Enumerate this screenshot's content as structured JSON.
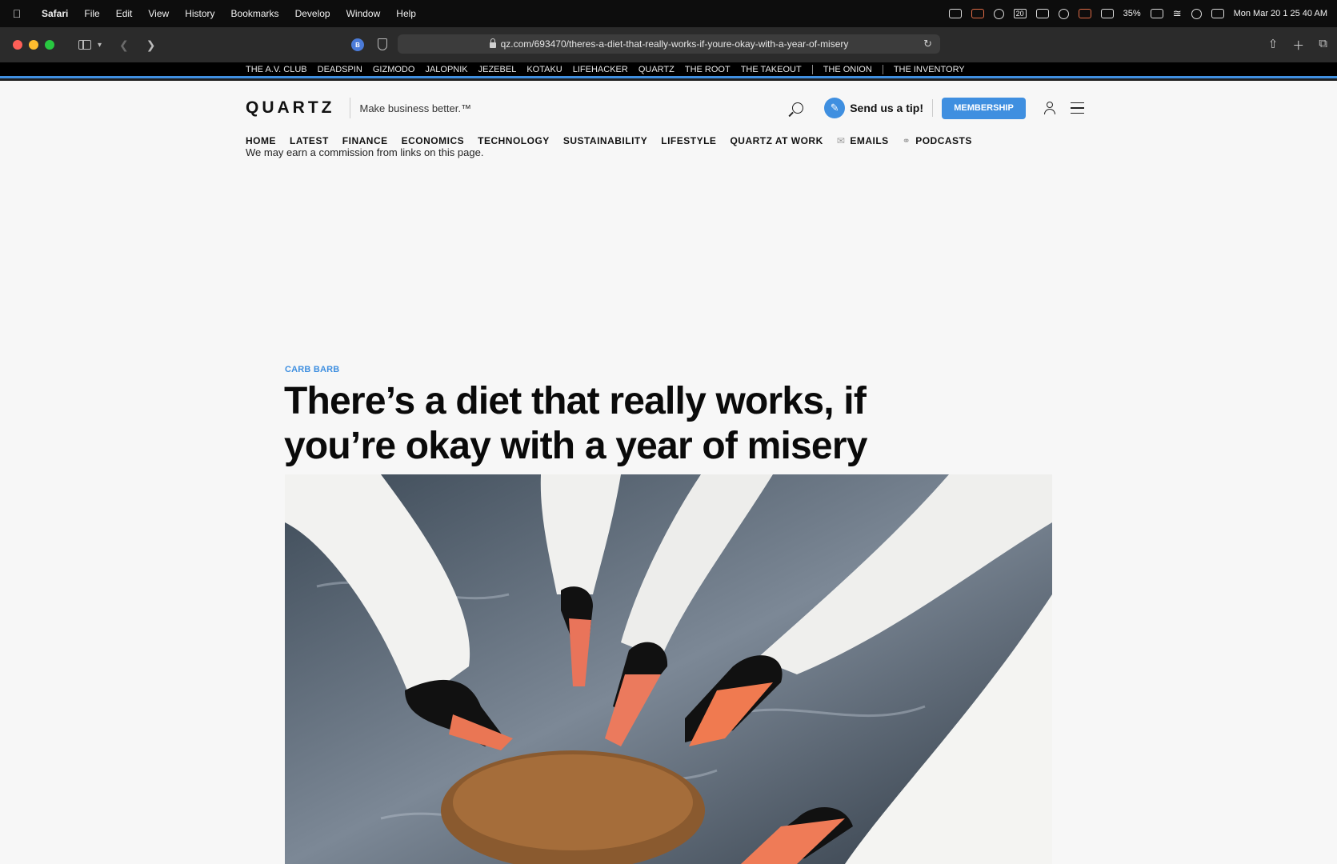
{
  "menubar": {
    "app": "Safari",
    "items": [
      "File",
      "Edit",
      "View",
      "History",
      "Bookmarks",
      "Develop",
      "Window",
      "Help"
    ],
    "calendar_day": "20",
    "battery": "35%",
    "clock": "Mon Mar 20  1 25 40 AM"
  },
  "browser": {
    "extension_badge": "B",
    "url": "qz.com/693470/theres-a-diet-that-really-works-if-youre-okay-with-a-year-of-misery"
  },
  "network": {
    "links": [
      "THE A.V. CLUB",
      "DEADSPIN",
      "GIZMODO",
      "JALOPNIK",
      "JEZEBEL",
      "KOTAKU",
      "LIFEHACKER",
      "QUARTZ",
      "THE ROOT",
      "THE TAKEOUT"
    ],
    "extra_links": [
      "THE ONION",
      "THE INVENTORY"
    ]
  },
  "site": {
    "logo": "QUARTZ",
    "tagline": "Make business better.™",
    "tip_label": "Send us a tip!",
    "membership_label": "MEMBERSHIP"
  },
  "nav": {
    "items": [
      "HOME",
      "LATEST",
      "FINANCE",
      "ECONOMICS",
      "TECHNOLOGY",
      "SUSTAINABILITY",
      "LIFESTYLE",
      "QUARTZ AT WORK"
    ],
    "emails": "EMAILS",
    "podcasts": "PODCASTS"
  },
  "disclaimer": "We may earn a commission from links on this page.",
  "article": {
    "category": "CARB BARB",
    "headline": "There’s a diet that really works, if you’re okay with a year of misery"
  },
  "colors": {
    "accent": "#3f8fe0",
    "network_bar": "#000000",
    "page_bg": "#f7f7f7"
  }
}
